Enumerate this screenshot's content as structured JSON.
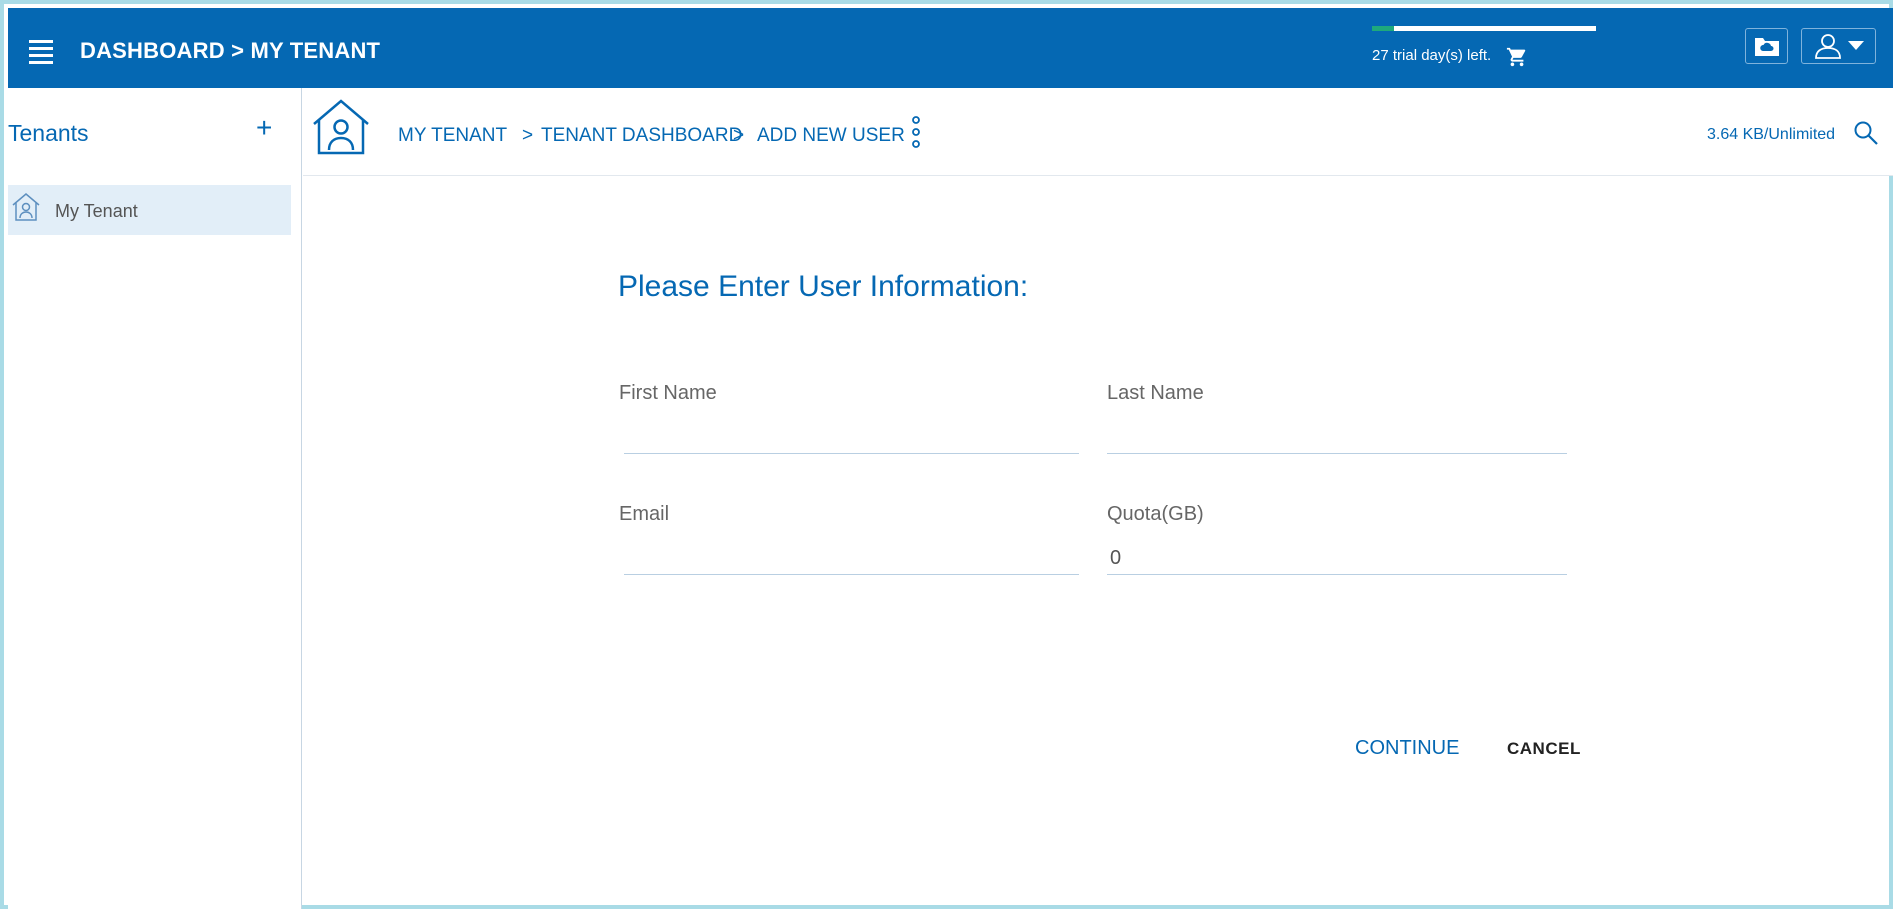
{
  "header": {
    "title": "DASHBOARD > MY TENANT",
    "trial_text": "27 trial day(s) left.",
    "trial_progress": 0.1,
    "colors": {
      "bar": "#0568b3",
      "progress": "#1ea97c"
    }
  },
  "sidebar": {
    "title": "Tenants",
    "add_label": "+",
    "items": [
      {
        "label": "My Tenant"
      }
    ]
  },
  "breadcrumb": {
    "items": [
      {
        "label": "MY TENANT"
      },
      {
        "label": "TENANT DASHBOARD"
      },
      {
        "label": "ADD NEW USER"
      }
    ],
    "separator": ">",
    "storage": "3.64 KB/Unlimited"
  },
  "form": {
    "title": "Please Enter User Information:",
    "first_name": {
      "label": "First Name",
      "value": ""
    },
    "last_name": {
      "label": "Last Name",
      "value": ""
    },
    "email": {
      "label": "Email",
      "value": ""
    },
    "quota": {
      "label": "Quota(GB)",
      "value": "0"
    },
    "continue_label": "CONTINUE",
    "cancel_label": "CANCEL"
  }
}
